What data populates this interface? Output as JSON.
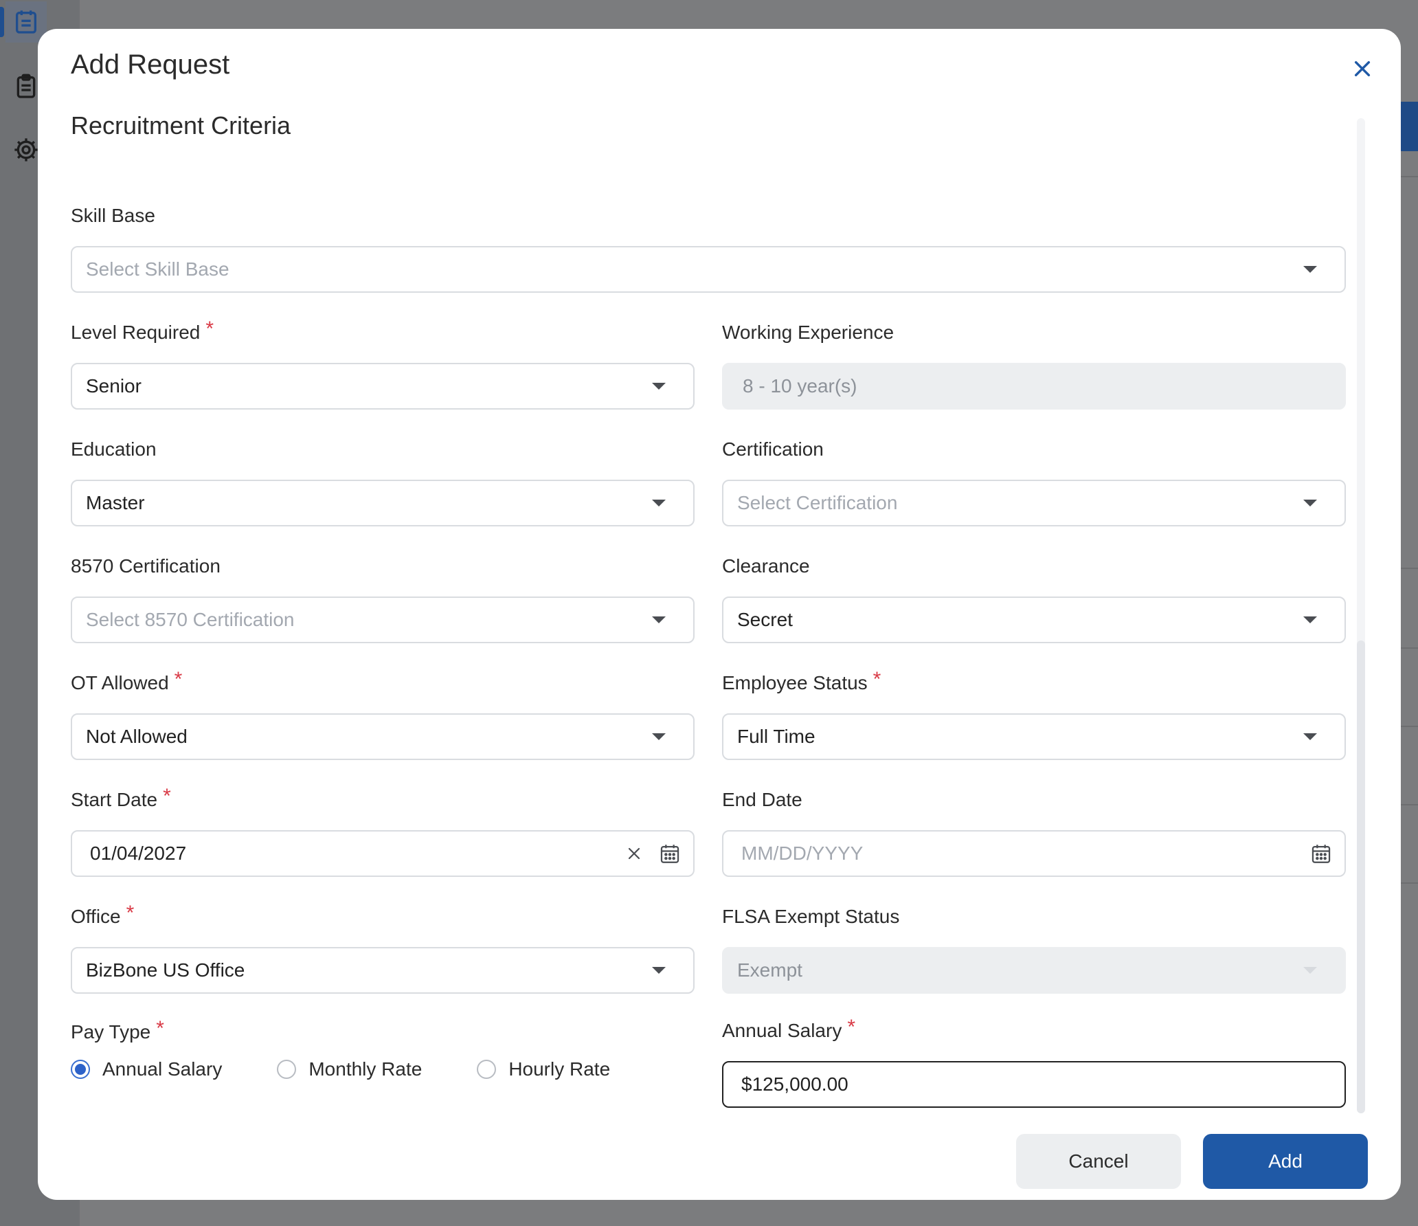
{
  "modal": {
    "title": "Add Request",
    "section_title": "Recruitment Criteria"
  },
  "fields": {
    "skill_base": {
      "label": "Skill Base",
      "placeholder": "Select Skill Base",
      "value": ""
    },
    "level_required": {
      "label": "Level Required",
      "value": "Senior",
      "required": "*"
    },
    "working_experience": {
      "label": "Working Experience",
      "value": "8 - 10 year(s)"
    },
    "education": {
      "label": "Education",
      "value": "Master"
    },
    "certification": {
      "label": "Certification",
      "placeholder": "Select Certification",
      "value": ""
    },
    "cert_8570": {
      "label": "8570 Certification",
      "placeholder": "Select 8570 Certification",
      "value": ""
    },
    "clearance": {
      "label": "Clearance",
      "value": "Secret"
    },
    "ot_allowed": {
      "label": "OT Allowed",
      "value": "Not Allowed",
      "required": "*"
    },
    "employee_status": {
      "label": "Employee Status",
      "value": "Full Time",
      "required": "*"
    },
    "start_date": {
      "label": "Start Date",
      "value": "01/04/2027",
      "required": "*"
    },
    "end_date": {
      "label": "End Date",
      "placeholder": "MM/DD/YYYY",
      "value": ""
    },
    "office": {
      "label": "Office",
      "value": "BizBone US Office",
      "required": "*"
    },
    "flsa_status": {
      "label": "FLSA Exempt Status",
      "value": "Exempt"
    },
    "pay_type": {
      "label": "Pay Type",
      "required": "*",
      "options": [
        "Annual Salary",
        "Monthly Rate",
        "Hourly Rate"
      ],
      "selected": "Annual Salary"
    },
    "annual_salary": {
      "label": "Annual Salary",
      "value": "$125,000.00",
      "required": "*"
    }
  },
  "actions": {
    "cancel_label": "Cancel",
    "add_label": "Add"
  },
  "icons": {
    "close": "close-icon",
    "dropdown": "chevron-down-icon",
    "calendar": "calendar-icon",
    "clear": "clear-icon"
  },
  "colors": {
    "primary": "#1f59a6",
    "required": "#d93b47",
    "radio_selected": "#2d62c9"
  }
}
